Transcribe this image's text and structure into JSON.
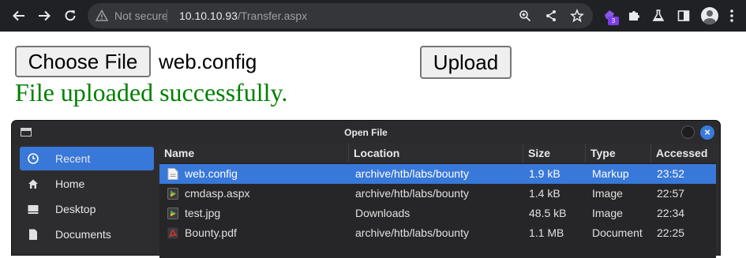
{
  "browser": {
    "security_label": "Not secure",
    "url_host": "10.10.10.93",
    "url_path": "/Transfer.aspx",
    "extension_badge": "3"
  },
  "page": {
    "choose_file_label": "Choose File",
    "selected_file": "web.config",
    "upload_label": "Upload",
    "success_message": "File uploaded successfully."
  },
  "dialog": {
    "title": "Open File",
    "close_glyph": "×",
    "sidebar": [
      {
        "label": "Recent",
        "icon": "clock-icon",
        "active": true
      },
      {
        "label": "Home",
        "icon": "home-icon",
        "active": false
      },
      {
        "label": "Desktop",
        "icon": "desktop-icon",
        "active": false
      },
      {
        "label": "Documents",
        "icon": "document-icon",
        "active": false
      }
    ],
    "columns": [
      "Name",
      "Location",
      "Size",
      "Type",
      "Accessed"
    ],
    "files": [
      {
        "name": "web.config",
        "location": "archive/htb/labs/bounty",
        "size": "1.9 kB",
        "type": "Markup",
        "accessed": "23:52",
        "icon": "text-file-icon",
        "selected": true
      },
      {
        "name": "cmdasp.aspx",
        "location": "archive/htb/labs/bounty",
        "size": "1.4 kB",
        "type": "Image",
        "accessed": "22:57",
        "icon": "image-file-icon",
        "selected": false
      },
      {
        "name": "test.jpg",
        "location": "Downloads",
        "size": "48.5 kB",
        "type": "Image",
        "accessed": "22:34",
        "icon": "image-file-icon",
        "selected": false
      },
      {
        "name": "Bounty.pdf",
        "location": "archive/htb/labs/bounty",
        "size": "1.1 MB",
        "type": "Document",
        "accessed": "22:25",
        "icon": "pdf-file-icon",
        "selected": false
      }
    ]
  },
  "colors": {
    "toolbar_bg": "#202124",
    "success_green": "#008000",
    "selection_blue": "#3878d8"
  }
}
